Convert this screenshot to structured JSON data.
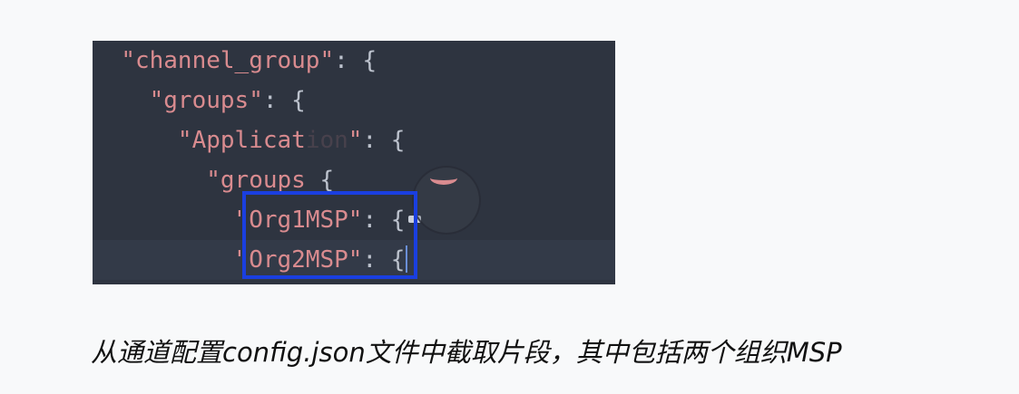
{
  "code": {
    "lines": [
      {
        "key": "\"channel_group\"",
        "sep": ": ",
        "tail": "{"
      },
      {
        "key": "\"groups\"",
        "sep": ": ",
        "tail": "{"
      },
      {
        "key": "\"Applicat",
        "hidden": "ion",
        "key_end": "\"",
        "sep": ": ",
        "tail": "{"
      },
      {
        "key": "\"groups",
        "sep": " ",
        "tail": "{"
      },
      {
        "key": "\"Org1MSP\"",
        "sep": ": ",
        "tail": "{"
      },
      {
        "key": "\"Org2MSP\"",
        "sep": ": ",
        "tail": "{"
      }
    ]
  },
  "caption": "从通道配置config.json文件中截取片段，其中包括两个组织MSP",
  "colors": {
    "editor_bg": "#2e3440",
    "string": "#d98b8f",
    "highlight_border": "#1a3fe0"
  }
}
